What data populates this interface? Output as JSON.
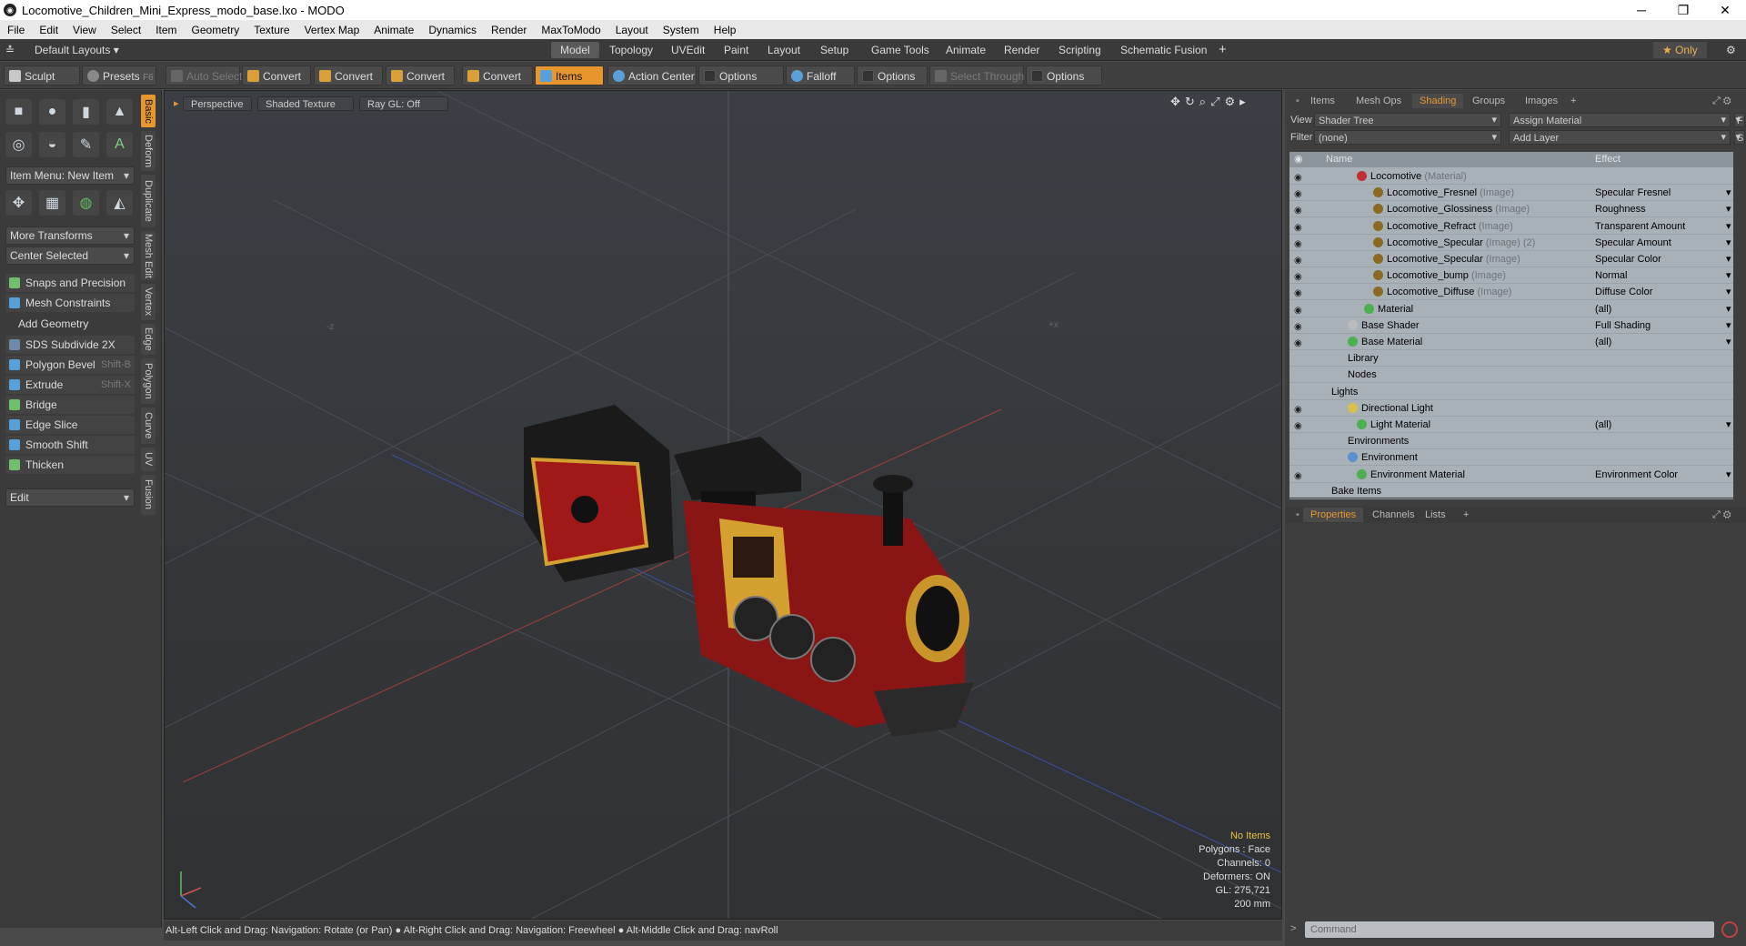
{
  "window": {
    "title": "Locomotive_Children_Mini_Express_modo_base.lxo - MODO",
    "controls": [
      "─",
      "❐",
      "✕"
    ]
  },
  "menu": [
    "File",
    "Edit",
    "View",
    "Select",
    "Item",
    "Geometry",
    "Texture",
    "Vertex Map",
    "Animate",
    "Dynamics",
    "Render",
    "MaxToModo",
    "Layout",
    "System",
    "Help"
  ],
  "layoutbar": {
    "layouts": "Default Layouts ▾",
    "tabs": [
      "Model",
      "Topology",
      "UVEdit",
      "Paint",
      "Layout",
      "Setup",
      "Game Tools",
      "Animate",
      "Render",
      "Scripting",
      "Schematic Fusion"
    ],
    "add": "+",
    "only": "★  Only",
    "gear": "⚙"
  },
  "toolbar": {
    "sculpt": "Sculpt",
    "presets": "Presets",
    "presets_key": "F6",
    "auto_select": "Auto Select",
    "convert": "Convert",
    "items": "Items",
    "action_center": "Action Center",
    "options": "Options",
    "falloff": "Falloff",
    "select_through": "Select Through"
  },
  "left": {
    "item_menu": "Item Menu: New Item",
    "more_transforms": "More Transforms",
    "center_selected": "Center Selected",
    "snaps": "Snaps and Precision",
    "mesh_constraints": "Mesh Constraints",
    "add_geometry": "Add Geometry",
    "tools": [
      {
        "label": "SDS Subdivide 2X",
        "key": ""
      },
      {
        "label": "Polygon Bevel",
        "key": "Shift-B"
      },
      {
        "label": "Extrude",
        "key": "Shift-X"
      },
      {
        "label": "Bridge",
        "key": ""
      },
      {
        "label": "Edge Slice",
        "key": ""
      },
      {
        "label": "Smooth Shift",
        "key": ""
      },
      {
        "label": "Thicken",
        "key": ""
      }
    ],
    "edit": "Edit",
    "vtabs": [
      "Basic",
      "Deform",
      "Duplicate",
      "Mesh Edit",
      "Vertex",
      "Edge",
      "Polygon",
      "Curve",
      "UV",
      "Fusion"
    ]
  },
  "viewport": {
    "view": "Perspective",
    "shading": "Shaded Texture",
    "raygl": "Ray GL: Off",
    "info": {
      "items": "No Items",
      "polygons": "Polygons : Face",
      "channels": "Channels: 0",
      "deformers": "Deformers: ON",
      "gl": "GL: 275,721",
      "scale": "200 mm"
    }
  },
  "status": "Alt-Left Click and Drag: Navigation: Rotate (or Pan) ● Alt-Right Click and Drag: Navigation: Freewheel ● Alt-Middle Click and Drag: navRoll",
  "right": {
    "tabs": [
      "Items",
      "Mesh Ops",
      "Shading",
      "Groups",
      "Images",
      "+"
    ],
    "view_label": "View",
    "view_value": "Shader Tree",
    "assign": "Assign Material",
    "f": "F",
    "filter_label": "Filter",
    "filter_value": "(none)",
    "add_layer": "Add Layer",
    "s": "S",
    "col_name": "Name",
    "col_effect": "Effect",
    "rows": [
      {
        "name": "Locomotive",
        "type": "(Material)",
        "effect": "",
        "ball": "#c03030"
      },
      {
        "name": "Locomotive_Fresnel",
        "type": "(Image)",
        "effect": "Specular Fresnel",
        "ball": "#8a6a20"
      },
      {
        "name": "Locomotive_Glossiness",
        "type": "(Image)",
        "effect": "Roughness",
        "ball": "#8a6a20"
      },
      {
        "name": "Locomotive_Refract",
        "type": "(Image)",
        "effect": "Transparent Amount",
        "ball": "#8a6a20"
      },
      {
        "name": "Locomotive_Specular",
        "type": "(Image) (2)",
        "effect": "Specular Amount",
        "ball": "#8a6a20"
      },
      {
        "name": "Locomotive_Specular",
        "type": "(Image)",
        "effect": "Specular Color",
        "ball": "#8a6a20"
      },
      {
        "name": "Locomotive_bump",
        "type": "(Image)",
        "effect": "Normal",
        "ball": "#8a6a20"
      },
      {
        "name": "Locomotive_Diffuse",
        "type": "(Image)",
        "effect": "Diffuse Color",
        "ball": "#8a6a20"
      },
      {
        "name": "Material",
        "type": "",
        "effect": "(all)",
        "ball": "#4caf50"
      },
      {
        "name": "Base Shader",
        "type": "",
        "effect": "Full Shading",
        "ball": "#bbbbbb"
      },
      {
        "name": "Base Material",
        "type": "",
        "effect": "(all)",
        "ball": "#4caf50"
      },
      {
        "name": "Library",
        "type": "",
        "effect": "",
        "ball": ""
      },
      {
        "name": "Nodes",
        "type": "",
        "effect": "",
        "ball": ""
      },
      {
        "name": "Lights",
        "type": "",
        "effect": "",
        "ball": ""
      },
      {
        "name": "Directional Light",
        "type": "",
        "effect": "",
        "ball": "#d8c24a"
      },
      {
        "name": "Light Material",
        "type": "",
        "effect": "(all)",
        "ball": "#4caf50"
      },
      {
        "name": "Environments",
        "type": "",
        "effect": "",
        "ball": ""
      },
      {
        "name": "Environment",
        "type": "",
        "effect": "",
        "ball": "#5a8fd0"
      },
      {
        "name": "Environment Material",
        "type": "",
        "effect": "Environment Color",
        "ball": "#4caf50"
      },
      {
        "name": "Bake Items",
        "type": "",
        "effect": "",
        "ball": ""
      }
    ],
    "prop_tabs": [
      "Properties",
      "Channels",
      "Lists",
      "+"
    ],
    "command_placeholder": "Command"
  }
}
